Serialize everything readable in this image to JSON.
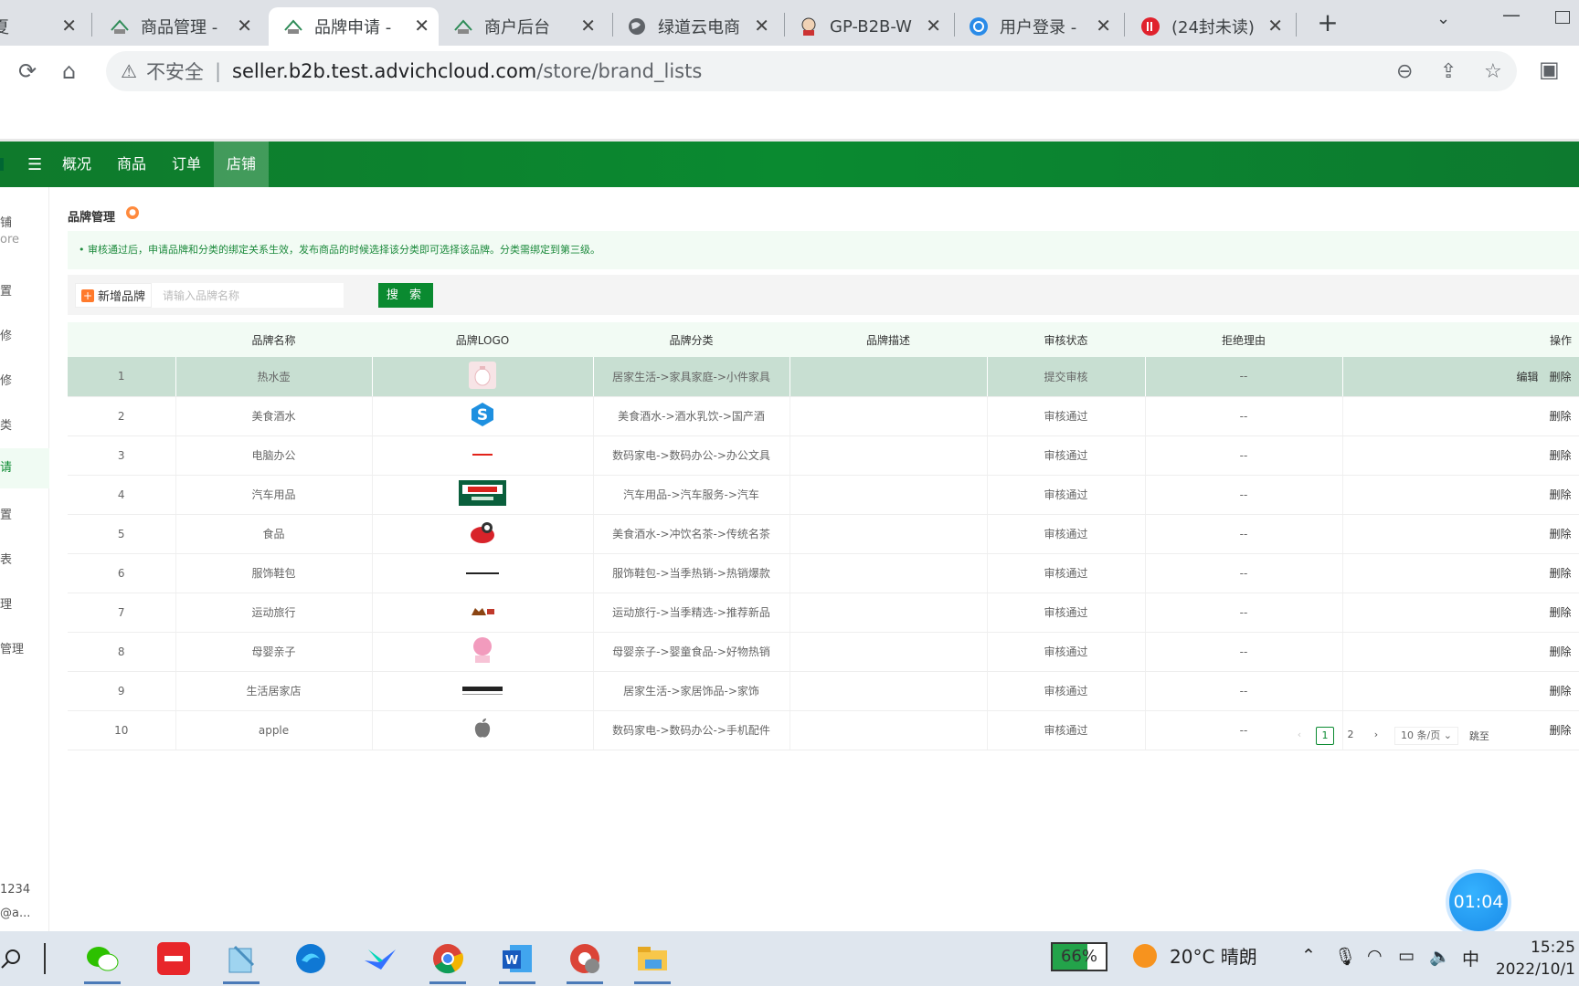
{
  "browser": {
    "tabs": [
      {
        "title": "夏",
        "icon": "unknown-icon"
      },
      {
        "title": "商品管理 -",
        "icon": "house-favicon-icon"
      },
      {
        "title": "品牌申请 -",
        "icon": "house-favicon-icon",
        "active": true
      },
      {
        "title": "商户后台",
        "icon": "house-favicon-icon"
      },
      {
        "title": "绿道云电商",
        "icon": "globe-icon"
      },
      {
        "title": "GP-B2B-W",
        "icon": "jenkins-icon"
      },
      {
        "title": "用户登录 -",
        "icon": "swirl-icon"
      },
      {
        "title": "(24封未读)",
        "icon": "mail-icon"
      }
    ],
    "insecure_label": "不安全",
    "url_host": "seller.b2b.test.advichcloud.com",
    "url_path": "/store/brand_lists"
  },
  "topnav": {
    "items": [
      {
        "label": "概况"
      },
      {
        "label": "商品"
      },
      {
        "label": "订单"
      },
      {
        "label": "店铺",
        "active": true
      }
    ]
  },
  "sidebar": {
    "items": [
      "铺",
      "ore",
      "置",
      "修",
      "修",
      "类",
      "请",
      "置",
      "表",
      "理",
      "管理"
    ],
    "footer": [
      "1234",
      "@a..."
    ]
  },
  "page": {
    "title": "品牌管理",
    "notice": "• 审核通过后，申请品牌和分类的绑定关系生效，发布商品的时候选择该分类即可选择该品牌。分类需绑定到第三级。",
    "add_button": "新增品牌",
    "search_placeholder": "请输入品牌名称",
    "search_button": "搜 索"
  },
  "table": {
    "headers": [
      "",
      "品牌名称",
      "品牌LOGO",
      "品牌分类",
      "品牌描述",
      "审核状态",
      "拒绝理由",
      "操作"
    ],
    "rows": [
      {
        "no": "1",
        "name": "热水壶",
        "logo": "kettle-logo",
        "category": "居家生活->家具家庭->小件家具",
        "desc": "",
        "status": "提交审核",
        "reason": "--",
        "ops": [
          "编辑",
          "删除"
        ],
        "selected": true
      },
      {
        "no": "2",
        "name": "美食酒水",
        "logo": "blue-s-logo",
        "category": "美食酒水->酒水乳饮->国产酒",
        "desc": "",
        "status": "审核通过",
        "reason": "--",
        "ops": [
          "删除"
        ]
      },
      {
        "no": "3",
        "name": "电脑办公",
        "logo": "lenovo-logo",
        "category": "数码家电->数码办公->办公文具",
        "desc": "",
        "status": "审核通过",
        "reason": "--",
        "ops": [
          "删除"
        ]
      },
      {
        "no": "4",
        "name": "汽车用品",
        "logo": "castrol-logo",
        "category": "汽车用品->汽车服务->汽车",
        "desc": "",
        "status": "审核通过",
        "reason": "--",
        "ops": [
          "删除"
        ]
      },
      {
        "no": "5",
        "name": "食品",
        "logo": "food-logo",
        "category": "美食酒水->冲饮名茶->传统名茶",
        "desc": "",
        "status": "审核通过",
        "reason": "--",
        "ops": [
          "删除"
        ]
      },
      {
        "no": "6",
        "name": "服饰鞋包",
        "logo": "jackjones-logo",
        "category": "服饰鞋包->当季热销->热销爆款",
        "desc": "",
        "status": "审核通过",
        "reason": "--",
        "ops": [
          "删除"
        ]
      },
      {
        "no": "7",
        "name": "运动旅行",
        "logo": "camel-logo",
        "category": "运动旅行->当季精选->推荐新品",
        "desc": "",
        "status": "审核通过",
        "reason": "--",
        "ops": [
          "删除"
        ]
      },
      {
        "no": "8",
        "name": "母婴亲子",
        "logo": "pink-baby-logo",
        "category": "母婴亲子->婴童食品->好物热销",
        "desc": "",
        "status": "审核通过",
        "reason": "--",
        "ops": [
          "删除"
        ]
      },
      {
        "no": "9",
        "name": "生活居家店",
        "logo": "home-store-logo",
        "category": "居家生活->家居饰品->家饰",
        "desc": "",
        "status": "审核通过",
        "reason": "--",
        "ops": [
          "删除"
        ]
      },
      {
        "no": "10",
        "name": "apple",
        "logo": "apple-logo",
        "category": "数码家电->数码办公->手机配件",
        "desc": "",
        "status": "审核通过",
        "reason": "--",
        "ops": [
          "删除"
        ]
      }
    ]
  },
  "pagination": {
    "pages": [
      "1",
      "2"
    ],
    "current": "1",
    "page_size": "10 条/页",
    "jump_label": "跳至"
  },
  "timer": "01:04",
  "taskbar": {
    "battery": "66%",
    "battery_level": 0.66,
    "weather": "20°C 晴朗",
    "ime": "中",
    "time": "15:25",
    "date": "2022/10/1"
  }
}
